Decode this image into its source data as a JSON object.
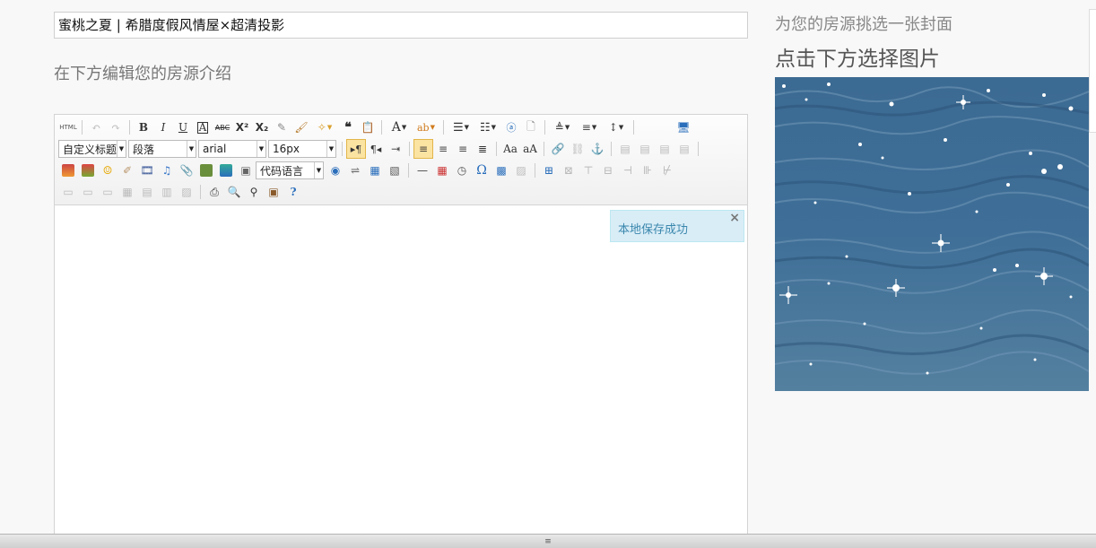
{
  "listing": {
    "title_value": "蜜桃之夏 | 希腊度假风情屋×超清投影"
  },
  "editor_section": {
    "heading": "在下方编辑您的房源介绍"
  },
  "toolbar": {
    "html_label": "HTML",
    "bold": "B",
    "italic": "I",
    "underline": "U",
    "font_border": "A",
    "strikethrough": "ABC",
    "superscript": "X²",
    "subscript": "X₂",
    "blockquote": "❝",
    "fore_color": "A",
    "combos": {
      "custom_title": "自定义标题",
      "paragraph": "段落",
      "font_family": "arial",
      "font_size": "16px",
      "code_language": "代码语言"
    },
    "special_char": "Ω"
  },
  "notice": {
    "text": "本地保存成功",
    "close": "×"
  },
  "cover_section": {
    "label": "为您的房源挑选一张封面",
    "title": "点击下方选择图片"
  },
  "bottom_bar": {
    "grip": "≡"
  },
  "colors": {
    "notice_bg": "#d9edf7",
    "notice_text": "#3a87ad",
    "active_button": "#fbe3a2"
  }
}
